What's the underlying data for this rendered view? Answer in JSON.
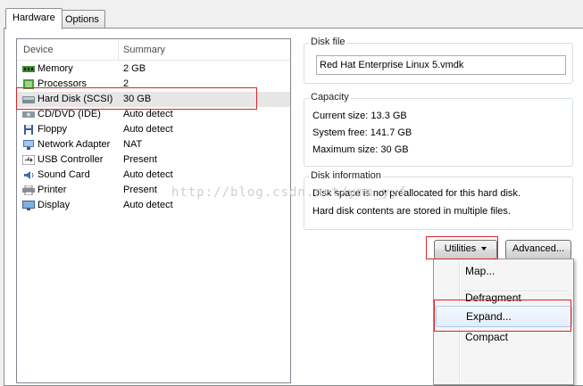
{
  "tabs": [
    {
      "label": "Hardware"
    },
    {
      "label": "Options"
    }
  ],
  "device_list": {
    "columns": [
      "Device",
      "Summary"
    ],
    "rows": [
      {
        "device": "Memory",
        "summary": "2 GB",
        "icon": "memory-icon"
      },
      {
        "device": "Processors",
        "summary": "2",
        "icon": "processor-icon"
      },
      {
        "device": "Hard Disk (SCSI)",
        "summary": "30 GB",
        "icon": "hard-disk-icon",
        "selected": true
      },
      {
        "device": "CD/DVD (IDE)",
        "summary": "Auto detect",
        "icon": "cd-dvd-icon"
      },
      {
        "device": "Floppy",
        "summary": "Auto detect",
        "icon": "floppy-icon"
      },
      {
        "device": "Network Adapter",
        "summary": "NAT",
        "icon": "network-adapter-icon"
      },
      {
        "device": "USB Controller",
        "summary": "Present",
        "icon": "usb-icon"
      },
      {
        "device": "Sound Card",
        "summary": "Auto detect",
        "icon": "sound-card-icon"
      },
      {
        "device": "Printer",
        "summary": "Present",
        "icon": "printer-icon"
      },
      {
        "device": "Display",
        "summary": "Auto detect",
        "icon": "display-icon"
      }
    ]
  },
  "disk_file": {
    "legend": "Disk file",
    "value": "Red Hat Enterprise Linux 5.vmdk"
  },
  "capacity": {
    "legend": "Capacity",
    "current": "Current size:  13.3 GB",
    "free": "System free:  141.7 GB",
    "max": "Maximum size:  30 GB"
  },
  "disk_info": {
    "legend": "Disk information",
    "line1": "Disk space is not preallocated for this hard disk.",
    "line2": "Hard disk contents are stored in multiple files."
  },
  "buttons": {
    "utilities": "Utilities",
    "advanced": "Advanced..."
  },
  "menu": {
    "map": "Map...",
    "defragment": "Defragment",
    "expand": "Expand...",
    "compact": "Compact"
  },
  "watermark": "http://blog.csdn.net/ymm_yyf",
  "colors": {
    "highlight_box": "#d9252a",
    "menu_hover": "#e2eefb"
  }
}
